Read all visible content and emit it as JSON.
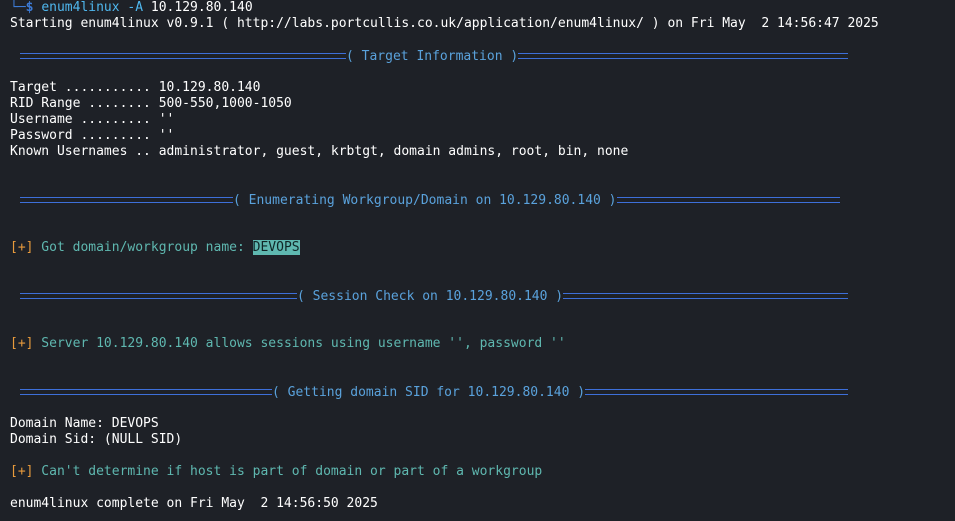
{
  "colors": {
    "background": "#1e2127",
    "prompt_blue": "#3d7bd6",
    "command_cyan": "#4fb7ee",
    "banner_text": "#5aa2dc",
    "status_tag": "#e89a3c",
    "status_text": "#5fb8b0"
  },
  "prompt": {
    "corner": "└─",
    "symbol": "$",
    "command": "enum4linux",
    "flag": "-A",
    "target": "10.129.80.140"
  },
  "starting_line": "Starting enum4linux v0.9.1 ( http://labs.portcullis.co.uk/application/enum4linux/ ) on Fri May  2 14:56:47 2025",
  "sections": {
    "target_info": "( Target Information )",
    "workgroup": "( Enumerating Workgroup/Domain on 10.129.80.140 )",
    "session": "( Session Check on 10.129.80.140 )",
    "domain_sid": "( Getting domain SID for 10.129.80.140 )"
  },
  "target_info": {
    "target": "Target ........... 10.129.80.140",
    "rid_range": "RID Range ........ 500-550,1000-1050",
    "username": "Username ......... ''",
    "password": "Password ......... ''",
    "known_usernames": "Known Usernames .. administrator, guest, krbtgt, domain admins, root, bin, none"
  },
  "results": {
    "tag": "[+]",
    "workgroup_msg": " Got domain/workgroup name: ",
    "workgroup_name": "DEVOPS",
    "session_msg": " Server 10.129.80.140 allows sessions using username '', password ''",
    "domain_name": "Domain Name: DEVOPS",
    "domain_sid": "Domain Sid: (NULL SID)",
    "domain_msg": " Can't determine if host is part of domain or part of a workgroup"
  },
  "complete_line": "enum4linux complete on Fri May  2 14:56:50 2025"
}
